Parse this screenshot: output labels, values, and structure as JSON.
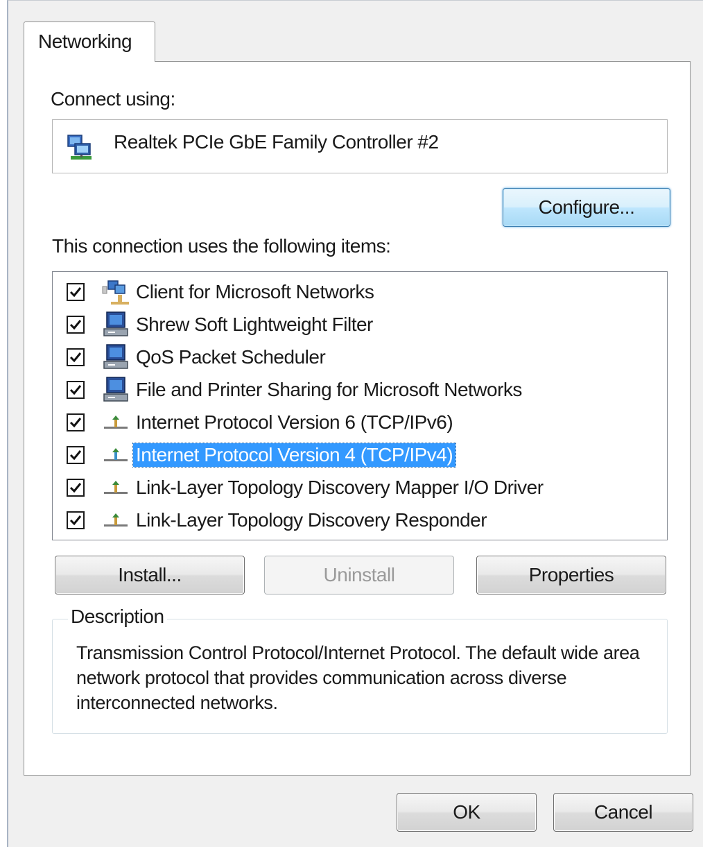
{
  "tab": {
    "label": "Networking"
  },
  "connect_using": {
    "label": "Connect using:",
    "adapter_name": "Realtek PCIe GbE Family Controller #2",
    "adapter_icon": "network-adapter-icon"
  },
  "buttons": {
    "configure": "Configure...",
    "install": "Install...",
    "uninstall": "Uninstall",
    "properties": "Properties",
    "ok": "OK",
    "cancel": "Cancel"
  },
  "items_label": "This connection uses the following items:",
  "items": [
    {
      "label": "Client for Microsoft Networks",
      "checked": true,
      "icon": "network-client-icon",
      "selected": false
    },
    {
      "label": "Shrew Soft Lightweight Filter",
      "checked": true,
      "icon": "network-service-icon",
      "selected": false
    },
    {
      "label": "QoS Packet Scheduler",
      "checked": true,
      "icon": "network-service-icon",
      "selected": false
    },
    {
      "label": "File and Printer Sharing for Microsoft Networks",
      "checked": true,
      "icon": "network-service-icon",
      "selected": false
    },
    {
      "label": "Internet Protocol Version 6 (TCP/IPv6)",
      "checked": true,
      "icon": "network-protocol-icon",
      "selected": false
    },
    {
      "label": "Internet Protocol Version 4 (TCP/IPv4)",
      "checked": true,
      "icon": "network-protocol-icon",
      "selected": true
    },
    {
      "label": "Link-Layer Topology Discovery Mapper I/O Driver",
      "checked": true,
      "icon": "network-protocol-icon",
      "selected": false
    },
    {
      "label": "Link-Layer Topology Discovery Responder",
      "checked": true,
      "icon": "network-protocol-icon",
      "selected": false
    }
  ],
  "description": {
    "legend": "Description",
    "text": "Transmission Control Protocol/Internet Protocol. The default wide area network protocol that provides communication across diverse interconnected networks."
  },
  "colors": {
    "selection": "#3399ff",
    "focus_button": "#3c7fb1"
  }
}
